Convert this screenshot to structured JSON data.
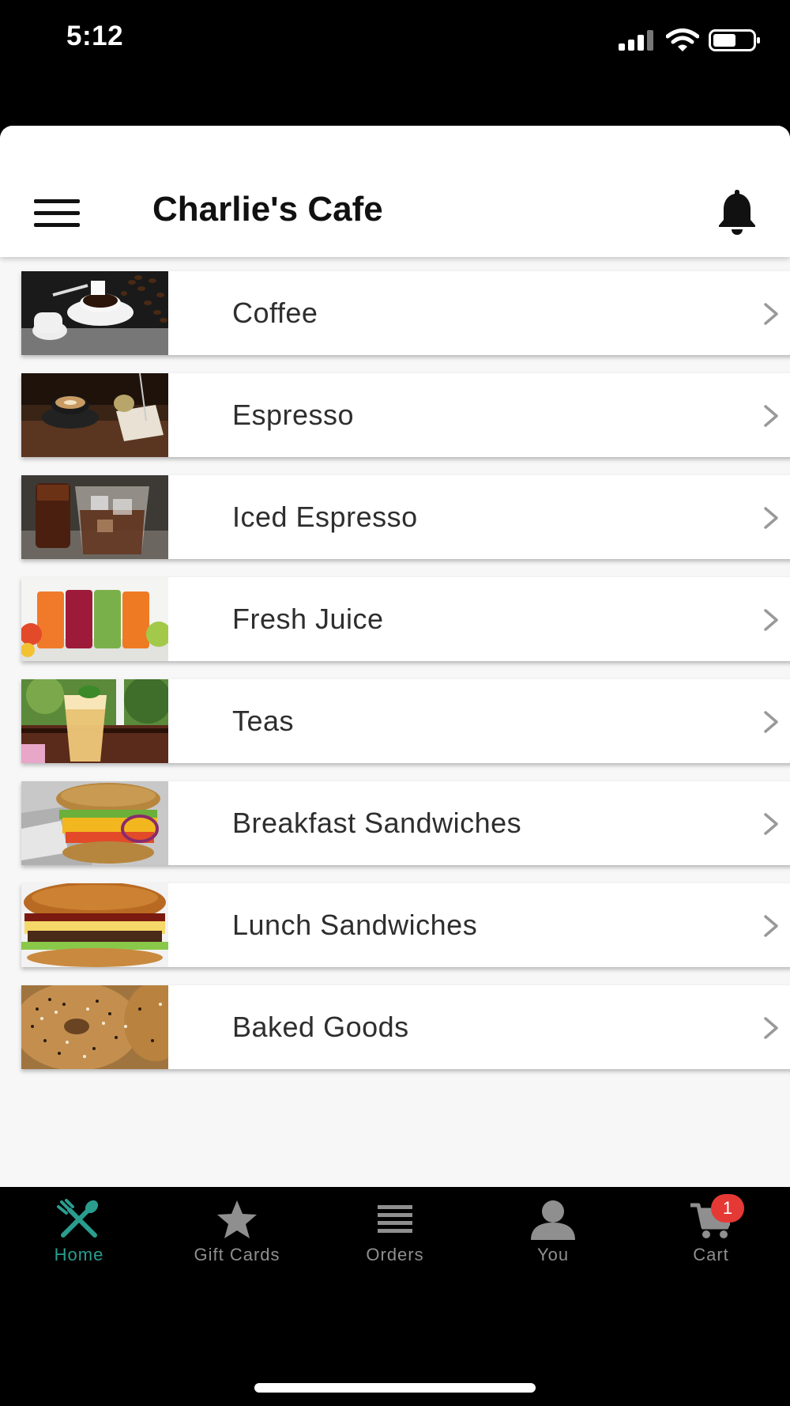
{
  "status_bar": {
    "time": "5:12"
  },
  "header": {
    "title": "Charlie's Cafe",
    "menu_icon": "hamburger-menu-icon",
    "notification_icon": "bell-icon"
  },
  "categories": [
    {
      "label": "Coffee",
      "thumb": "coffee-photo"
    },
    {
      "label": "Espresso",
      "thumb": "espresso-photo"
    },
    {
      "label": "Iced Espresso",
      "thumb": "iced-espresso-photo"
    },
    {
      "label": "Fresh Juice",
      "thumb": "fresh-juice-photo"
    },
    {
      "label": "Teas",
      "thumb": "teas-photo"
    },
    {
      "label": "Breakfast Sandwiches",
      "thumb": "breakfast-sandwich-photo"
    },
    {
      "label": "Lunch Sandwiches",
      "thumb": "lunch-sandwich-photo"
    },
    {
      "label": "Baked Goods",
      "thumb": "baked-goods-photo"
    }
  ],
  "tab_bar": {
    "tabs": [
      {
        "label": "Home",
        "icon": "fork-spoon-icon",
        "active": true
      },
      {
        "label": "Gift Cards",
        "icon": "star-icon",
        "active": false
      },
      {
        "label": "Orders",
        "icon": "list-icon",
        "active": false
      },
      {
        "label": "You",
        "icon": "person-icon",
        "active": false
      },
      {
        "label": "Cart",
        "icon": "cart-icon",
        "active": false
      }
    ],
    "cart_badge": "1"
  },
  "colors": {
    "accent": "#2a9d8f",
    "badge": "#e53935",
    "inactive_tab": "#8f8f8f"
  }
}
